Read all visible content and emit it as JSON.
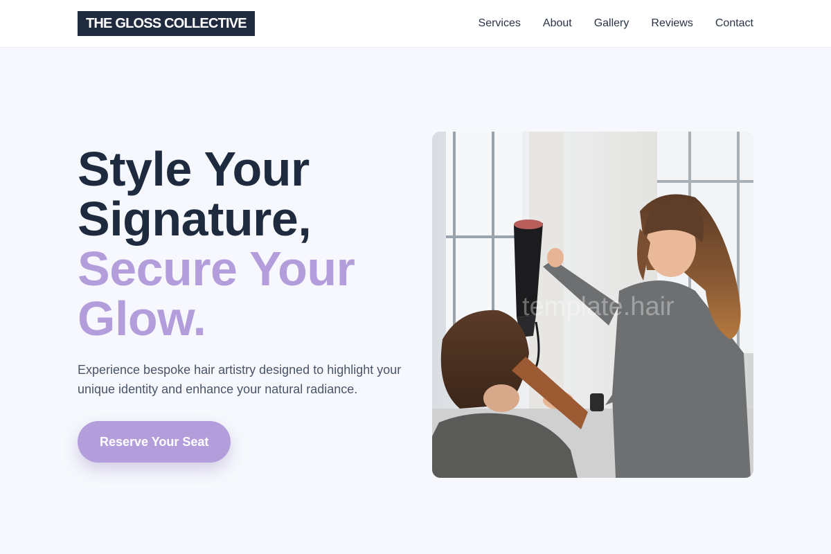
{
  "brand": {
    "name": "THE GLOSS COLLECTIVE"
  },
  "nav": {
    "items": [
      "Services",
      "About",
      "Gallery",
      "Reviews",
      "Contact"
    ]
  },
  "hero": {
    "headline_line1": "Style Your",
    "headline_line2": "Signature,",
    "accent_line1": "Secure Your",
    "accent_line2": "Glow.",
    "subtitle": "Experience bespoke hair artistry designed to highlight your unique identity and enhance your natural radiance.",
    "cta_label": "Reserve Your Seat",
    "image_watermark": "template.hair"
  },
  "colors": {
    "brand_dark": "#1f2a3e",
    "accent": "#b39ddb",
    "background": "#f6f8fd"
  }
}
